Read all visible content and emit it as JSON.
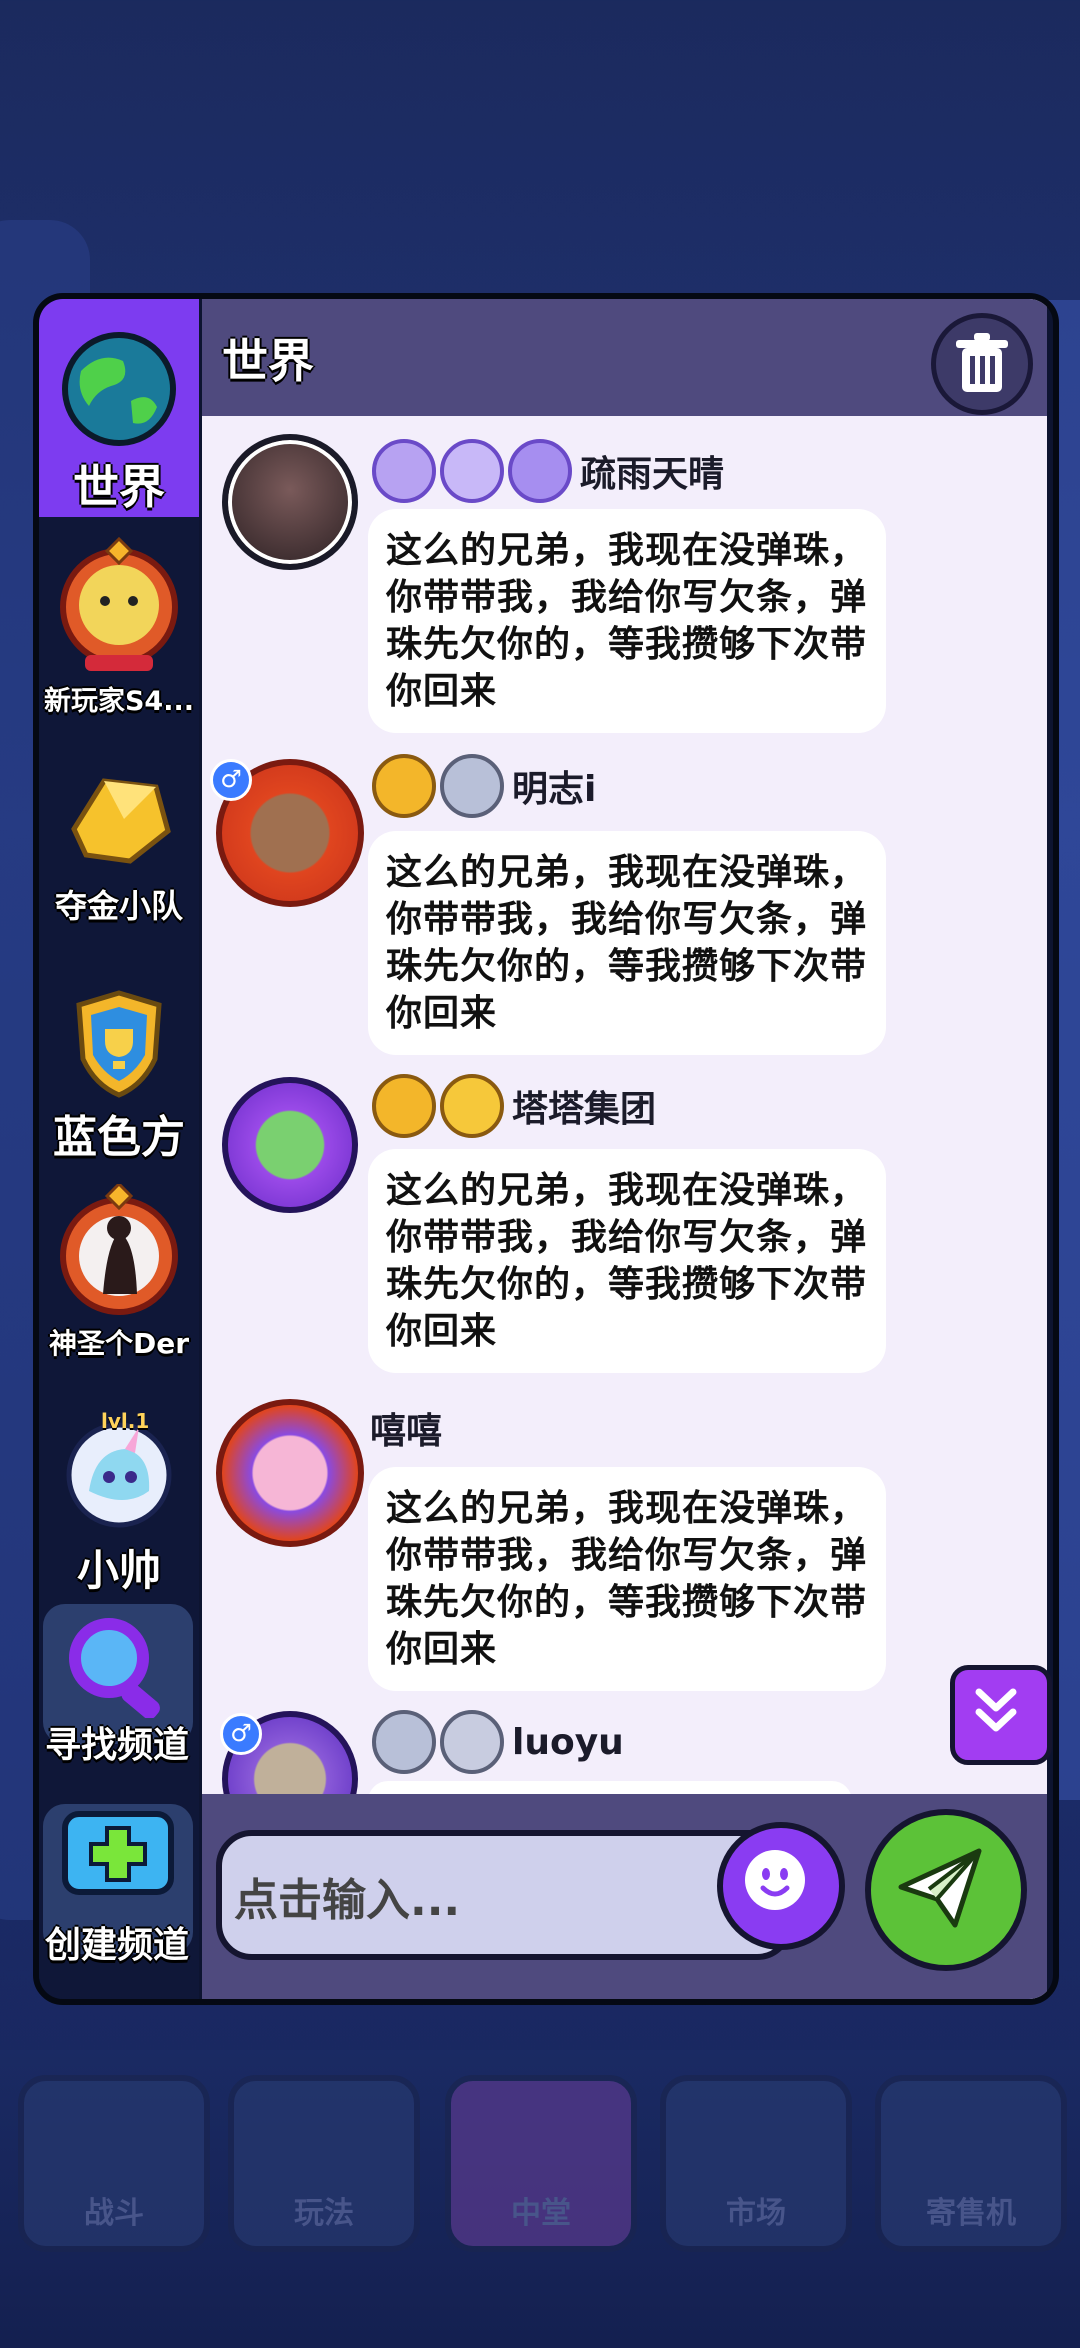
{
  "background": {
    "nav_labels": [
      "战斗",
      "玩法",
      "中堂",
      "市场",
      "寄售机"
    ]
  },
  "sidebar": {
    "items": [
      {
        "label": "世界",
        "icon": "globe-icon"
      },
      {
        "label": "新玩家S4...",
        "icon": "fox-emblem-icon"
      },
      {
        "label": "夺金小队",
        "icon": "gold-nugget-icon"
      },
      {
        "label": "蓝色方",
        "icon": "trophy-shield-icon"
      },
      {
        "label": "神圣个Der",
        "icon": "avatar-emblem-icon"
      },
      {
        "label": "小帅",
        "icon": "unicorn-avatar-icon",
        "level": "lvl.1"
      },
      {
        "label": "寻找频道",
        "icon": "magnifier-icon"
      },
      {
        "label": "创建频道",
        "icon": "plus-icon"
      }
    ]
  },
  "header": {
    "title": "世界"
  },
  "messages": [
    {
      "username": "疏雨天晴",
      "text": "这么的兄弟，我现在没弹珠，你带带我，我给你写欠条，弹珠先欠你的，等我攒够下次带你回来"
    },
    {
      "username": "明志i",
      "text": "这么的兄弟，我现在没弹珠，你带带我，我给你写欠条，弹珠先欠你的，等我攒够下次带你回来",
      "gender": "♂"
    },
    {
      "username": "塔塔集团",
      "text": "这么的兄弟，我现在没弹珠，你带带我，我给你写欠条，弹珠先欠你的，等我攒够下次带你回来"
    },
    {
      "username": "嘻嘻",
      "text": "这么的兄弟，我现在没弹珠，你带带我，我给你写欠条，弹珠先欠你的，等我攒够下次带你回来"
    },
    {
      "username": "luoyu",
      "text": "",
      "gender": "♂"
    }
  ],
  "input": {
    "placeholder": "点击输入..."
  },
  "colors": {
    "accent": "#7d3cf0",
    "send": "#5cc238",
    "header": "#4f4a7e"
  }
}
